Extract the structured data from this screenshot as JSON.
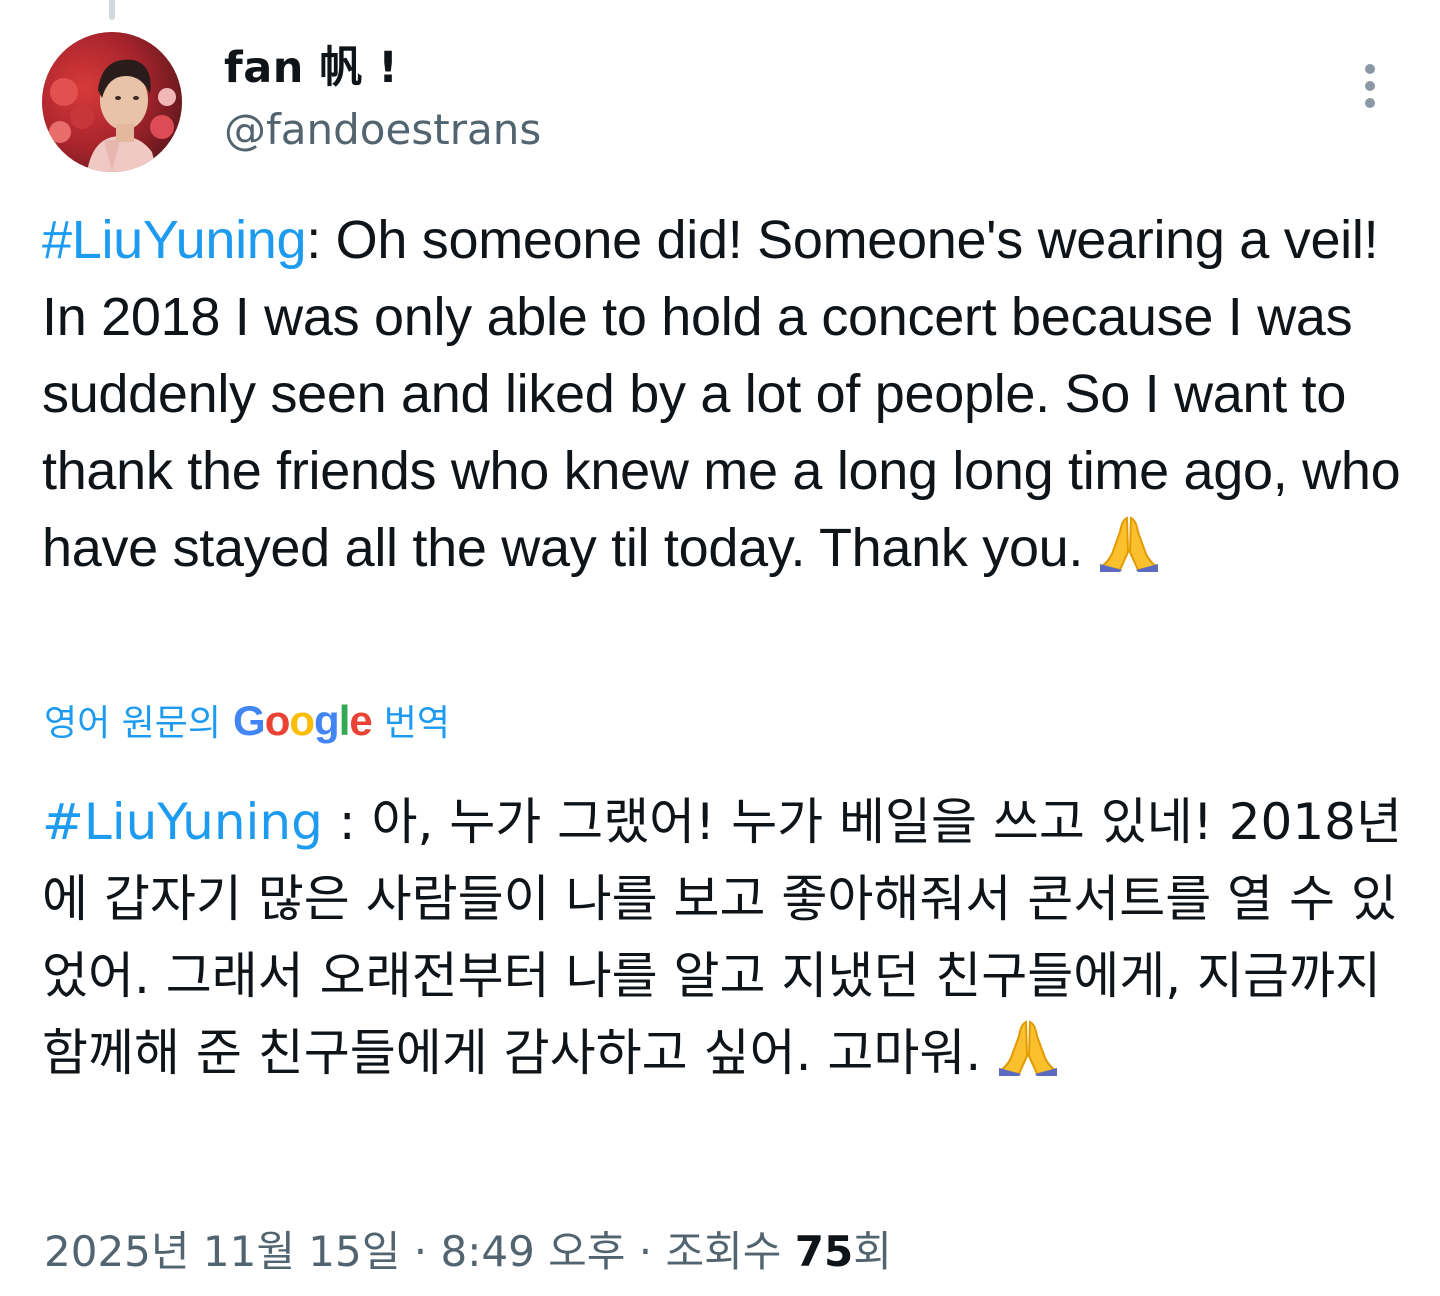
{
  "author": {
    "display_name": "fan 帆 !",
    "handle": "@fandoestrans",
    "avatar_icon": "profile-photo"
  },
  "more_icon": "more-vertical-icon",
  "tweet": {
    "hashtag": "#LiuYuning",
    "body": ": Oh someone did! Someone's wearing a veil! In 2018 I was only able to hold a concert because I was suddenly seen and liked by a lot of people. So I want to thank the friends who knew me a long long time ago, who have stayed all the way til today. Thank you. ",
    "emoji": "folded-hands"
  },
  "translation_link": {
    "prefix": "영어 원문의",
    "brand": "Google",
    "suffix": "번역"
  },
  "translation": {
    "hashtag": "#LiuYuning",
    "body": " : 아, 누가 그랬어! 누가 베일을 쓰고 있네! 2018년에 갑자기 많은 사람들이 나를 보고 좋아해줘서 콘서트를 열 수 있었어. 그래서 오래전부터 나를 알고 지냈던 친구들에게, 지금까지 함께해 준 친구들에게 감사하고 싶어. 고마워. ",
    "emoji": "folded-hands"
  },
  "meta": {
    "date": "2025년 11월 15일",
    "separator": "·",
    "time": "8:49 오후",
    "views_label": "조회수",
    "views_count": "75",
    "views_suffix": "회"
  },
  "colors": {
    "link": "#1d9bf0",
    "text": "#0f1419",
    "secondary": "#536471"
  }
}
